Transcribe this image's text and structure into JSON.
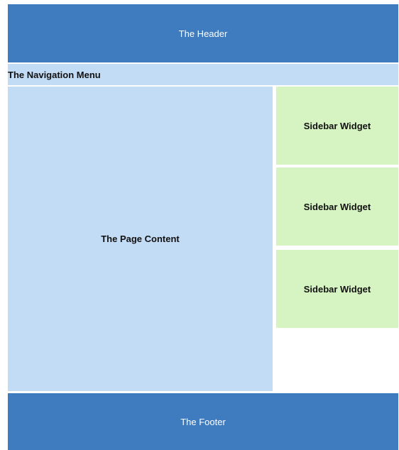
{
  "header": {
    "label": "The Header"
  },
  "nav": {
    "label": "The Navigation Menu"
  },
  "content": {
    "label": "The Page Content"
  },
  "sidebar": {
    "widgets": [
      {
        "label": "Sidebar Widget"
      },
      {
        "label": "Sidebar Widget"
      },
      {
        "label": "Sidebar Widget"
      }
    ]
  },
  "footer": {
    "label": "The Footer"
  },
  "colors": {
    "header_footer": "#3f7bbf",
    "nav_content": "#c2dcf5",
    "widget": "#d6f4c2"
  }
}
